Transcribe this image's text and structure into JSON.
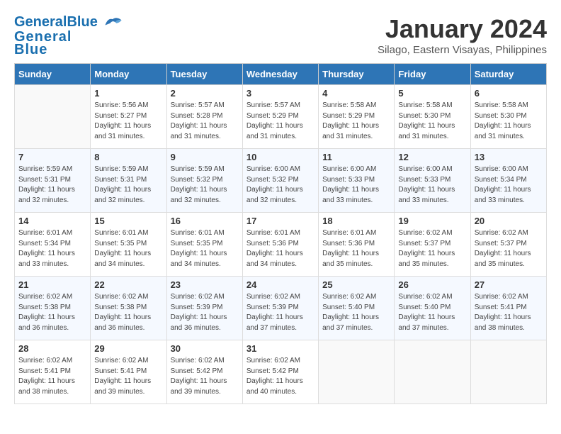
{
  "header": {
    "logo_general": "General",
    "logo_blue": "Blue",
    "month_title": "January 2024",
    "location": "Silago, Eastern Visayas, Philippines"
  },
  "days_of_week": [
    "Sunday",
    "Monday",
    "Tuesday",
    "Wednesday",
    "Thursday",
    "Friday",
    "Saturday"
  ],
  "weeks": [
    [
      {
        "day": "",
        "info": ""
      },
      {
        "day": "1",
        "info": "Sunrise: 5:56 AM\nSunset: 5:27 PM\nDaylight: 11 hours\nand 31 minutes."
      },
      {
        "day": "2",
        "info": "Sunrise: 5:57 AM\nSunset: 5:28 PM\nDaylight: 11 hours\nand 31 minutes."
      },
      {
        "day": "3",
        "info": "Sunrise: 5:57 AM\nSunset: 5:29 PM\nDaylight: 11 hours\nand 31 minutes."
      },
      {
        "day": "4",
        "info": "Sunrise: 5:58 AM\nSunset: 5:29 PM\nDaylight: 11 hours\nand 31 minutes."
      },
      {
        "day": "5",
        "info": "Sunrise: 5:58 AM\nSunset: 5:30 PM\nDaylight: 11 hours\nand 31 minutes."
      },
      {
        "day": "6",
        "info": "Sunrise: 5:58 AM\nSunset: 5:30 PM\nDaylight: 11 hours\nand 31 minutes."
      }
    ],
    [
      {
        "day": "7",
        "info": "Sunrise: 5:59 AM\nSunset: 5:31 PM\nDaylight: 11 hours\nand 32 minutes."
      },
      {
        "day": "8",
        "info": "Sunrise: 5:59 AM\nSunset: 5:31 PM\nDaylight: 11 hours\nand 32 minutes."
      },
      {
        "day": "9",
        "info": "Sunrise: 5:59 AM\nSunset: 5:32 PM\nDaylight: 11 hours\nand 32 minutes."
      },
      {
        "day": "10",
        "info": "Sunrise: 6:00 AM\nSunset: 5:32 PM\nDaylight: 11 hours\nand 32 minutes."
      },
      {
        "day": "11",
        "info": "Sunrise: 6:00 AM\nSunset: 5:33 PM\nDaylight: 11 hours\nand 33 minutes."
      },
      {
        "day": "12",
        "info": "Sunrise: 6:00 AM\nSunset: 5:33 PM\nDaylight: 11 hours\nand 33 minutes."
      },
      {
        "day": "13",
        "info": "Sunrise: 6:00 AM\nSunset: 5:34 PM\nDaylight: 11 hours\nand 33 minutes."
      }
    ],
    [
      {
        "day": "14",
        "info": "Sunrise: 6:01 AM\nSunset: 5:34 PM\nDaylight: 11 hours\nand 33 minutes."
      },
      {
        "day": "15",
        "info": "Sunrise: 6:01 AM\nSunset: 5:35 PM\nDaylight: 11 hours\nand 34 minutes."
      },
      {
        "day": "16",
        "info": "Sunrise: 6:01 AM\nSunset: 5:35 PM\nDaylight: 11 hours\nand 34 minutes."
      },
      {
        "day": "17",
        "info": "Sunrise: 6:01 AM\nSunset: 5:36 PM\nDaylight: 11 hours\nand 34 minutes."
      },
      {
        "day": "18",
        "info": "Sunrise: 6:01 AM\nSunset: 5:36 PM\nDaylight: 11 hours\nand 35 minutes."
      },
      {
        "day": "19",
        "info": "Sunrise: 6:02 AM\nSunset: 5:37 PM\nDaylight: 11 hours\nand 35 minutes."
      },
      {
        "day": "20",
        "info": "Sunrise: 6:02 AM\nSunset: 5:37 PM\nDaylight: 11 hours\nand 35 minutes."
      }
    ],
    [
      {
        "day": "21",
        "info": "Sunrise: 6:02 AM\nSunset: 5:38 PM\nDaylight: 11 hours\nand 36 minutes."
      },
      {
        "day": "22",
        "info": "Sunrise: 6:02 AM\nSunset: 5:38 PM\nDaylight: 11 hours\nand 36 minutes."
      },
      {
        "day": "23",
        "info": "Sunrise: 6:02 AM\nSunset: 5:39 PM\nDaylight: 11 hours\nand 36 minutes."
      },
      {
        "day": "24",
        "info": "Sunrise: 6:02 AM\nSunset: 5:39 PM\nDaylight: 11 hours\nand 37 minutes."
      },
      {
        "day": "25",
        "info": "Sunrise: 6:02 AM\nSunset: 5:40 PM\nDaylight: 11 hours\nand 37 minutes."
      },
      {
        "day": "26",
        "info": "Sunrise: 6:02 AM\nSunset: 5:40 PM\nDaylight: 11 hours\nand 37 minutes."
      },
      {
        "day": "27",
        "info": "Sunrise: 6:02 AM\nSunset: 5:41 PM\nDaylight: 11 hours\nand 38 minutes."
      }
    ],
    [
      {
        "day": "28",
        "info": "Sunrise: 6:02 AM\nSunset: 5:41 PM\nDaylight: 11 hours\nand 38 minutes."
      },
      {
        "day": "29",
        "info": "Sunrise: 6:02 AM\nSunset: 5:41 PM\nDaylight: 11 hours\nand 39 minutes."
      },
      {
        "day": "30",
        "info": "Sunrise: 6:02 AM\nSunset: 5:42 PM\nDaylight: 11 hours\nand 39 minutes."
      },
      {
        "day": "31",
        "info": "Sunrise: 6:02 AM\nSunset: 5:42 PM\nDaylight: 11 hours\nand 40 minutes."
      },
      {
        "day": "",
        "info": ""
      },
      {
        "day": "",
        "info": ""
      },
      {
        "day": "",
        "info": ""
      }
    ]
  ]
}
